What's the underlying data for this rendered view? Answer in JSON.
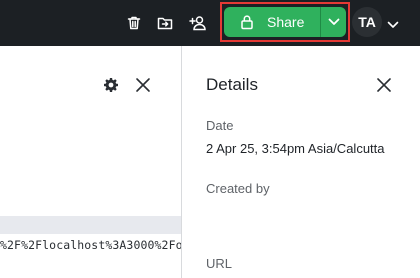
{
  "toolbar": {
    "icons": [
      "trash-icon",
      "move-to-folder-icon",
      "add-user-icon"
    ],
    "share_label": "Share",
    "share_color": "#2fb15d",
    "highlight_color": "#e53935",
    "avatar_initials": "TA"
  },
  "left_pane": {
    "url_snippet": "%2F%2Flocalhost%3A3000%2Fo"
  },
  "details": {
    "title": "Details",
    "fields": [
      {
        "label": "Date",
        "value": "2 Apr 25, 3:54pm Asia/Calcutta"
      },
      {
        "label": "Created by",
        "value": ""
      },
      {
        "label": "URL",
        "value": ""
      }
    ]
  }
}
